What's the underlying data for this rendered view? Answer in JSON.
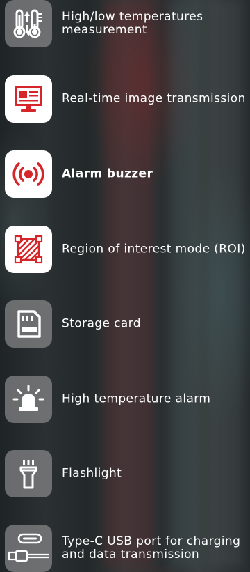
{
  "features": [
    {
      "icon": "thermometer-high-low-icon",
      "style": "gray",
      "lines": [
        "High/low temperatures",
        "measurement"
      ]
    },
    {
      "icon": "monitor-transmission-icon",
      "style": "white",
      "lines": [
        "Real-time image transmission"
      ]
    },
    {
      "icon": "alarm-buzzer-icon",
      "style": "white",
      "lines": [
        "Alarm buzzer"
      ]
    },
    {
      "icon": "roi-region-icon",
      "style": "white",
      "lines": [
        "Region of interest mode (ROI)"
      ]
    },
    {
      "icon": "sd-card-icon",
      "style": "gray",
      "lines": [
        "Storage card"
      ]
    },
    {
      "icon": "siren-alarm-icon",
      "style": "gray",
      "lines": [
        "High temperature alarm"
      ]
    },
    {
      "icon": "flashlight-icon",
      "style": "gray",
      "lines": [
        "Flashlight"
      ]
    },
    {
      "icon": "usb-type-c-icon",
      "style": "gray",
      "lines": [
        "Type-C USB port for charging",
        "and data transmission"
      ]
    }
  ],
  "colors": {
    "accent_red": "#d6262a",
    "text": "#ffffff",
    "tile_gray": "rgba(150,150,150,0.62)",
    "tile_white": "#ffffff"
  }
}
